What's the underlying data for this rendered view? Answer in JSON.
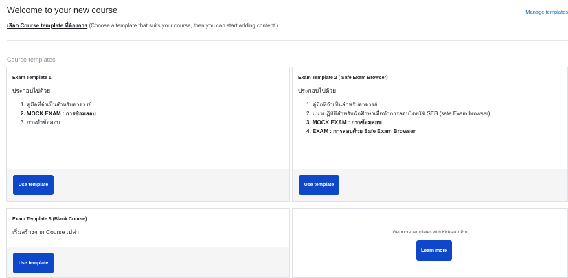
{
  "header": {
    "title": "Welcome to your new course",
    "manage_link": "Manage templates",
    "subtitle_strong": "เลือก Course template ที่ต้องการ",
    "subtitle_rest": " (Choose a template that suits your course, then you can start adding content.)"
  },
  "section_label": "Course templates",
  "cards": [
    {
      "title": "Exam Template 1",
      "description": "ประกอบไปด้วย",
      "items": [
        "1. คู่มือที่จำเป็นสำหรับอาจารย์",
        "2. MOCK EXAM : การซ้อมสอบ",
        "3. การทำข้อสอบ"
      ],
      "button": "Use template"
    },
    {
      "title": "Exam Template 2 ( Safe Exam Browser)",
      "description": "ประกอบไปด้วย",
      "items": [
        "1. คู่มือที่จำเป็นสำหรับอาจารย์",
        "2. แนวปฏิบัติสำหรับนักศึกษาเมื่อทำการสอบโดยใช้ SEB (safe Exam browser)",
        "3. MOCK EXAM : การซ้อมสอบ",
        "4. EXAM : การสอบด้วย Safe Exam Browser"
      ],
      "button": "Use template"
    },
    {
      "title": "Exam Template 3 (Blank Course)",
      "description": "เริ่มสร้างจาก Course เปล่า",
      "button": "Use template"
    }
  ],
  "promo": {
    "text": "Get more templates with Kickstart Pro",
    "button": "Learn more"
  }
}
